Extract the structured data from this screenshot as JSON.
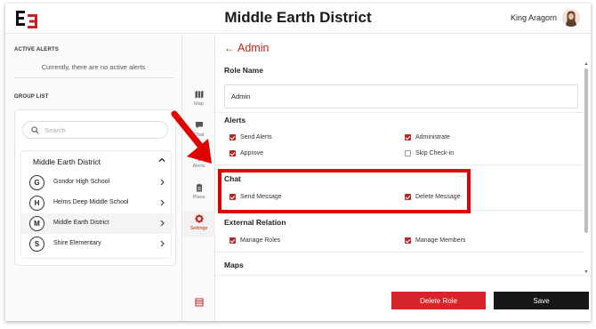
{
  "header": {
    "title": "Middle Earth District",
    "user_name": "King Aragorn"
  },
  "alerts": {
    "label": "ACTIVE ALERTS",
    "empty_text": "Currently, there are no active alerts"
  },
  "group_list": {
    "label": "GROUP LIST",
    "search_placeholder": "Search",
    "district": "Middle Earth District",
    "schools": [
      {
        "initial": "G",
        "name": "Gondor High School"
      },
      {
        "initial": "H",
        "name": "Helms Deep Middle School"
      },
      {
        "initial": "M",
        "name": "Middle Earth District"
      },
      {
        "initial": "S",
        "name": "Shire Elementary"
      }
    ]
  },
  "rail": {
    "items": [
      {
        "label": "Map",
        "icon": "map-icon"
      },
      {
        "label": "Chat",
        "icon": "chat-icon"
      },
      {
        "label": "Alerts",
        "icon": "alerts-icon"
      },
      {
        "label": "Plans",
        "icon": "plans-icon"
      },
      {
        "label": "Settings",
        "icon": "gear-icon"
      }
    ],
    "bottom_icon": "list-icon"
  },
  "admin": {
    "back_title": "Admin",
    "role_name_label": "Role Name",
    "role_name_value": "Admin",
    "sections": {
      "alerts": {
        "title": "Alerts",
        "items": [
          {
            "label": "Send Alerts",
            "checked": true
          },
          {
            "label": "Administrate",
            "checked": true
          },
          {
            "label": "Approve",
            "checked": true
          },
          {
            "label": "Skip Check-in",
            "checked": false
          }
        ]
      },
      "chat": {
        "title": "Chat",
        "items": [
          {
            "label": "Send Message",
            "checked": true
          },
          {
            "label": "Delete Message",
            "checked": true
          }
        ]
      },
      "external": {
        "title": "External Relation",
        "items": [
          {
            "label": "Manage Roles",
            "checked": true
          },
          {
            "label": "Manage Members",
            "checked": true
          }
        ]
      },
      "maps": {
        "title": "Maps"
      }
    },
    "delete_label": "Delete Role",
    "save_label": "Save"
  },
  "colors": {
    "accent": "#c8211f",
    "checkbox": "#b32a2a",
    "delete_button": "#d6252a",
    "save_button": "#161616",
    "annotation": "#e00000"
  }
}
